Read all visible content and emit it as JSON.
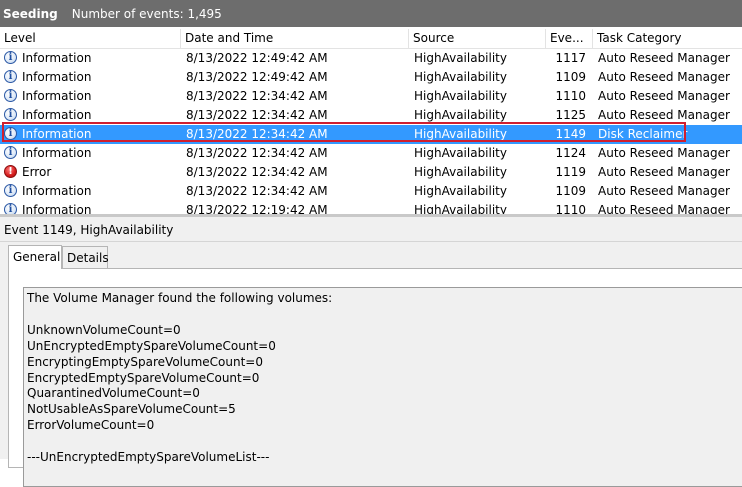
{
  "title_bar": {
    "name": "Seeding",
    "count_text": "Number of events: 1,495"
  },
  "columns": [
    "Level",
    "Date and Time",
    "Source",
    "Eve...",
    "Task Category"
  ],
  "rows": [
    {
      "icon": "information-icon",
      "level": "Information",
      "datetime": "8/13/2022 12:49:42 AM",
      "source": "HighAvailability",
      "event_id": "1117",
      "task": "Auto Reseed Manager"
    },
    {
      "icon": "information-icon",
      "level": "Information",
      "datetime": "8/13/2022 12:49:42 AM",
      "source": "HighAvailability",
      "event_id": "1109",
      "task": "Auto Reseed Manager"
    },
    {
      "icon": "information-icon",
      "level": "Information",
      "datetime": "8/13/2022 12:34:42 AM",
      "source": "HighAvailability",
      "event_id": "1110",
      "task": "Auto Reseed Manager"
    },
    {
      "icon": "information-icon",
      "level": "Information",
      "datetime": "8/13/2022 12:34:42 AM",
      "source": "HighAvailability",
      "event_id": "1125",
      "task": "Auto Reseed Manager"
    },
    {
      "icon": "information-icon",
      "level": "Information",
      "datetime": "8/13/2022 12:34:42 AM",
      "source": "HighAvailability",
      "event_id": "1149",
      "task": "Disk Reclaimer",
      "selected": true
    },
    {
      "icon": "information-icon",
      "level": "Information",
      "datetime": "8/13/2022 12:34:42 AM",
      "source": "HighAvailability",
      "event_id": "1124",
      "task": "Auto Reseed Manager"
    },
    {
      "icon": "error-icon",
      "level": "Error",
      "datetime": "8/13/2022 12:34:42 AM",
      "source": "HighAvailability",
      "event_id": "1119",
      "task": "Auto Reseed Manager"
    },
    {
      "icon": "information-icon",
      "level": "Information",
      "datetime": "8/13/2022 12:34:42 AM",
      "source": "HighAvailability",
      "event_id": "1109",
      "task": "Auto Reseed Manager"
    },
    {
      "icon": "information-icon",
      "level": "Information",
      "datetime": "8/13/2022 12:19:42 AM",
      "source": "HighAvailability",
      "event_id": "1110",
      "task": "Auto Reseed Manager"
    }
  ],
  "details": {
    "event_title": "Event 1149, HighAvailability",
    "tabs": [
      "General",
      "Details"
    ],
    "description": "The Volume Manager found the following volumes:\n\nUnknownVolumeCount=0\nUnEncryptedEmptySpareVolumeCount=0\nEncryptingEmptySpareVolumeCount=0\nEncryptedEmptySpareVolumeCount=0\nQuarantinedVolumeCount=0\nNotUsableAsSpareVolumeCount=5\nErrorVolumeCount=0\n\n---UnEncryptedEmptySpareVolumeList---"
  },
  "colors": {
    "selection": "#3399ff",
    "highlight_outline": "#d01f2f",
    "title_bar": "#6d6d6d"
  }
}
